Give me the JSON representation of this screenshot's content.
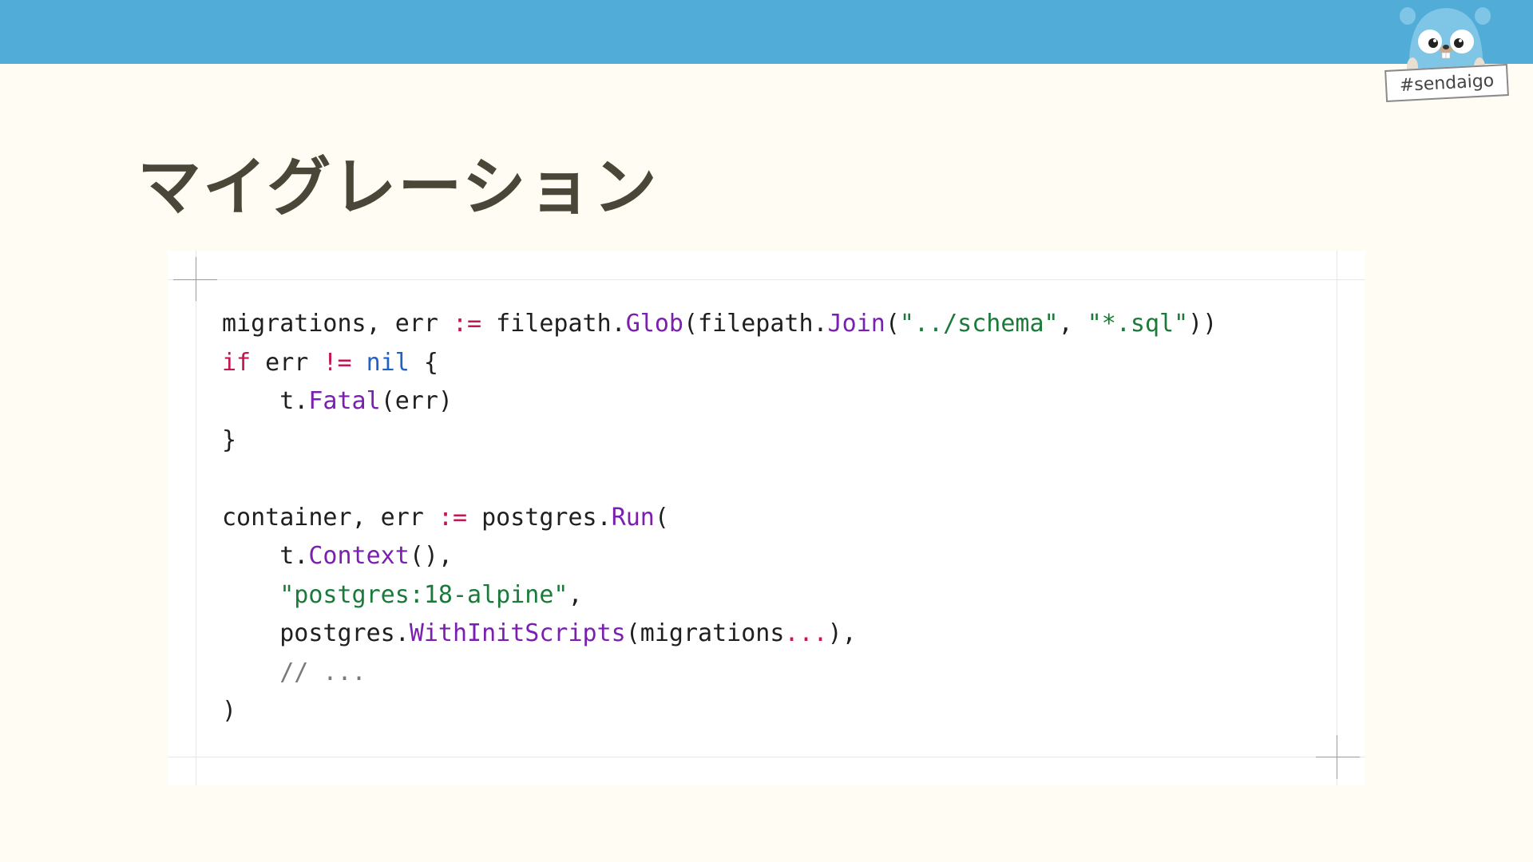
{
  "header": {
    "bar_color": "#51acd7",
    "badge_text": "#sendaigo",
    "badge_icon": "gopher-mascot-icon"
  },
  "slide": {
    "title": "マイグレーション"
  },
  "code": {
    "l1": {
      "a": "migrations, err ",
      "op": ":=",
      "b": " filepath.",
      "fn1": "Glob",
      "c": "(filepath.",
      "fn2": "Join",
      "d": "(",
      "s1": "\"../schema\"",
      "e": ", ",
      "s2": "\"*.sql\"",
      "f": "))"
    },
    "l2": {
      "kw": "if",
      "a": " err ",
      "op": "!=",
      "b": " ",
      "bi": "nil",
      "c": " {"
    },
    "l3": {
      "a": "    t.",
      "fn": "Fatal",
      "b": "(err)"
    },
    "l4": {
      "a": "}"
    },
    "l6": {
      "a": "container, err ",
      "op": ":=",
      "b": " postgres.",
      "fn": "Run",
      "c": "("
    },
    "l7": {
      "a": "    t.",
      "fn": "Context",
      "b": "(),"
    },
    "l8": {
      "a": "    ",
      "s": "\"postgres:18-alpine\"",
      "b": ","
    },
    "l9": {
      "a": "    postgres.",
      "fn": "WithInitScripts",
      "b": "(migrations",
      "op": "...",
      "c": "),"
    },
    "l10": {
      "a": "    ",
      "cm": "// ..."
    },
    "l11": {
      "a": ")"
    }
  },
  "colors": {
    "background": "#fffcf3",
    "title": "#4a4739",
    "keyword": "#c4174f",
    "function": "#7a1fb0",
    "string": "#1b7a3a",
    "builtin": "#1e62c8",
    "comment": "#7a7a7a"
  }
}
